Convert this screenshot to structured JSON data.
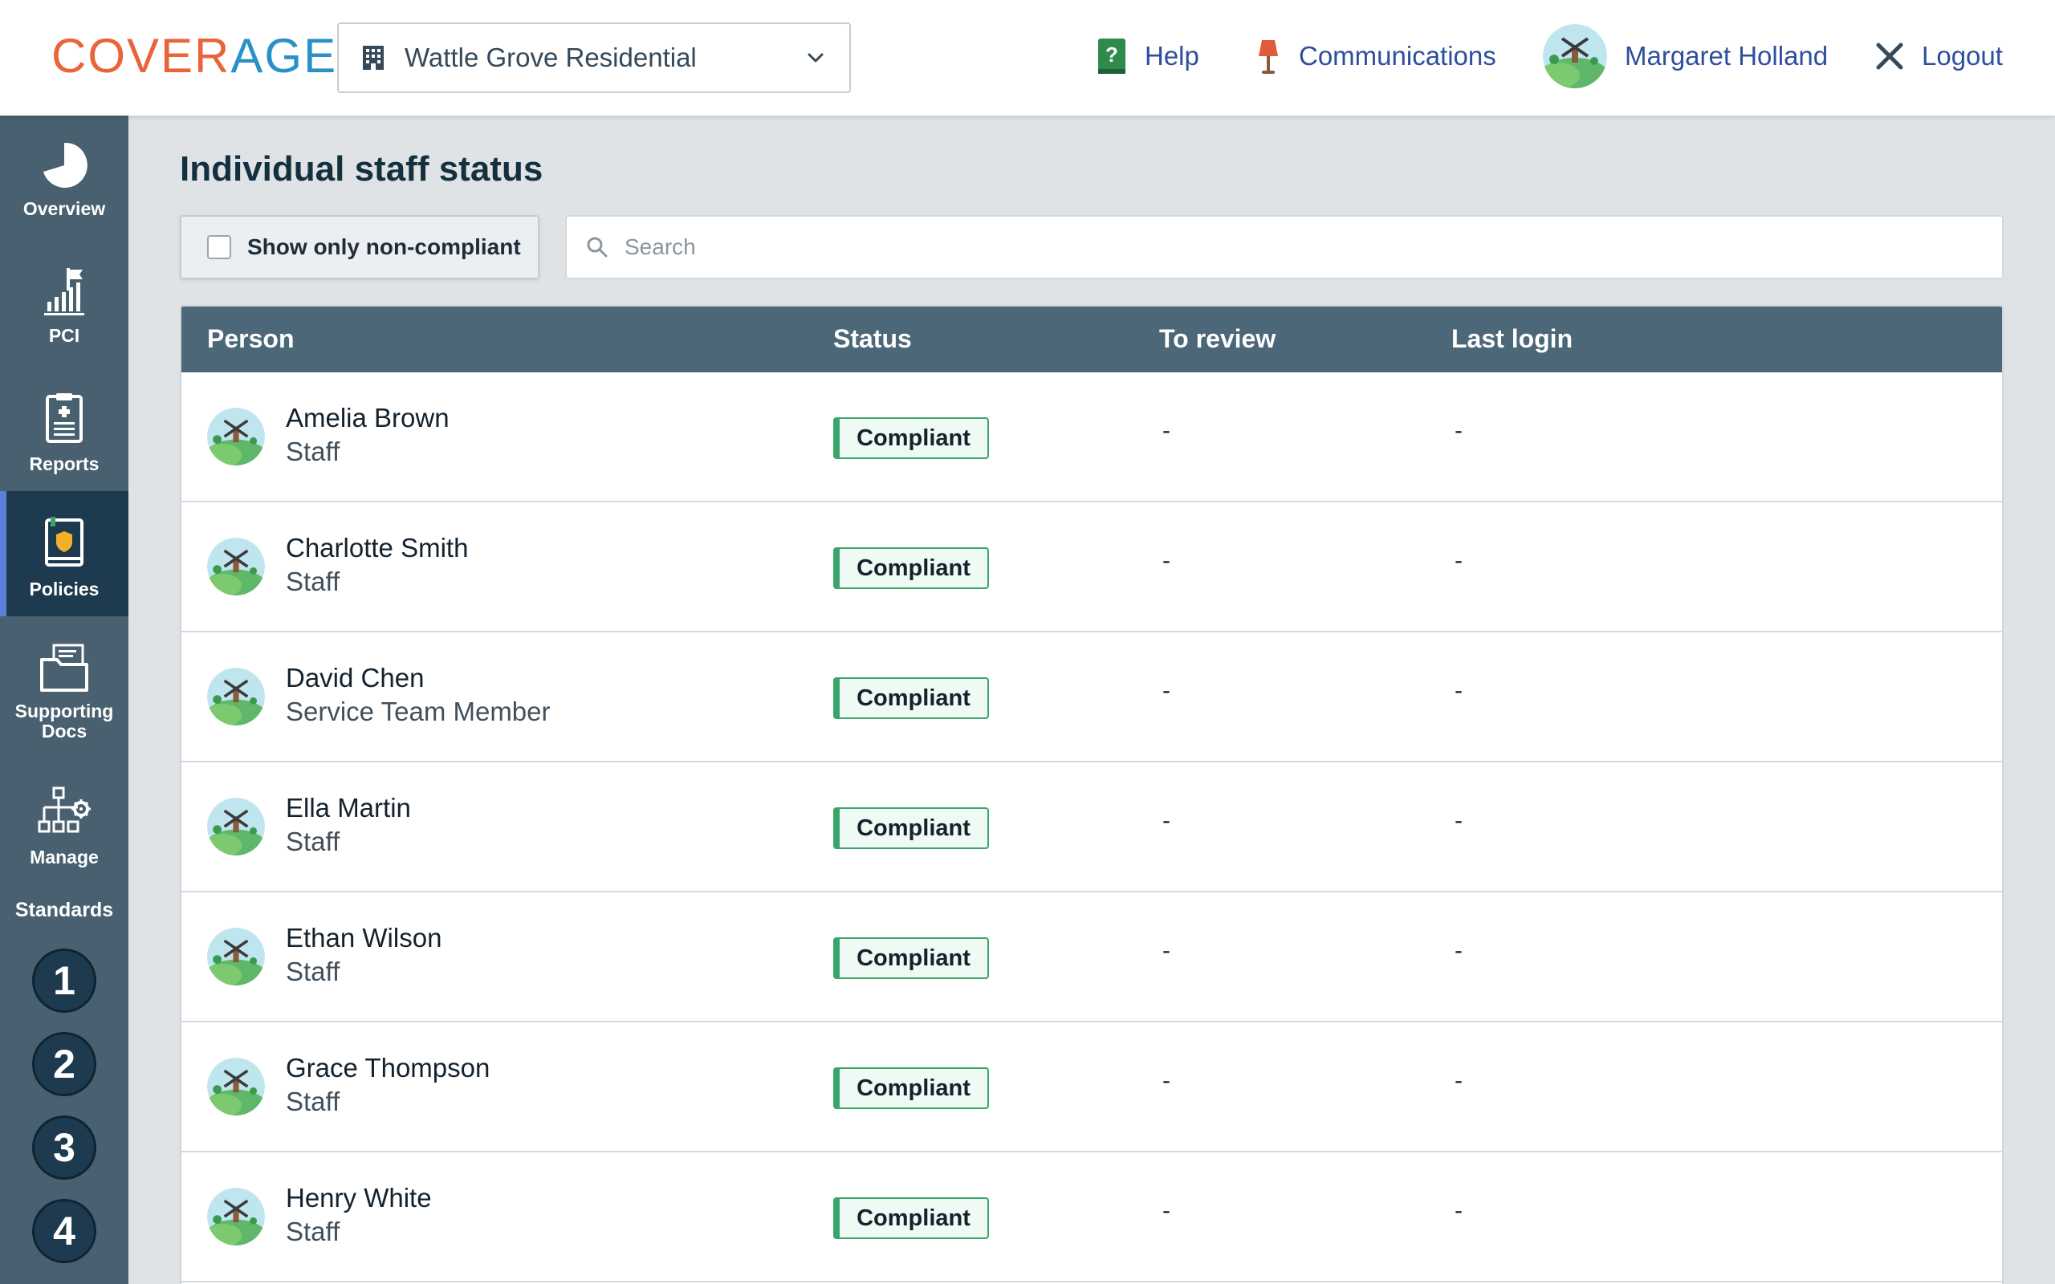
{
  "brand": {
    "part1": "COVER",
    "part2": "AGE"
  },
  "facility": {
    "name": "Wattle Grove Residential"
  },
  "header": {
    "help": "Help",
    "communications": "Communications",
    "user": "Margaret Holland",
    "logout": "Logout"
  },
  "sidebar": {
    "items": [
      {
        "label": "Overview",
        "icon": "pie-chart-icon"
      },
      {
        "label": "PCI",
        "icon": "bar-chart-flag-icon"
      },
      {
        "label": "Reports",
        "icon": "clipboard-icon"
      },
      {
        "label": "Policies",
        "icon": "shield-document-icon",
        "active": true
      },
      {
        "label": "Supporting Docs",
        "icon": "folder-docs-icon"
      },
      {
        "label": "Manage",
        "icon": "org-chart-gear-icon"
      }
    ],
    "standards_title": "Standards",
    "standards": [
      "1",
      "2",
      "3",
      "4"
    ]
  },
  "main": {
    "title": "Individual staff status",
    "filter_label": "Show only non-compliant",
    "search_placeholder": "Search",
    "columns": [
      "Person",
      "Status",
      "To review",
      "Last login"
    ],
    "rows": [
      {
        "name": "Amelia Brown",
        "role": "Staff",
        "status": "Compliant",
        "to_review": "-",
        "last_login": "-"
      },
      {
        "name": "Charlotte Smith",
        "role": "Staff",
        "status": "Compliant",
        "to_review": "-",
        "last_login": "-"
      },
      {
        "name": "David Chen",
        "role": "Service Team Member",
        "status": "Compliant",
        "to_review": "-",
        "last_login": "-"
      },
      {
        "name": "Ella Martin",
        "role": "Staff",
        "status": "Compliant",
        "to_review": "-",
        "last_login": "-"
      },
      {
        "name": "Ethan Wilson",
        "role": "Staff",
        "status": "Compliant",
        "to_review": "-",
        "last_login": "-"
      },
      {
        "name": "Grace Thompson",
        "role": "Staff",
        "status": "Compliant",
        "to_review": "-",
        "last_login": "-"
      },
      {
        "name": "Henry White",
        "role": "Staff",
        "status": "Compliant",
        "to_review": "-",
        "last_login": "-"
      }
    ]
  },
  "colors": {
    "brand_orange": "#e8653a",
    "brand_blue": "#2b90c7",
    "sidebar": "#48606f",
    "sidebar_active": "#1d3a4e",
    "table_header": "#4c6778",
    "compliant_green": "#3aa56b",
    "link_blue": "#2e4f9c"
  }
}
